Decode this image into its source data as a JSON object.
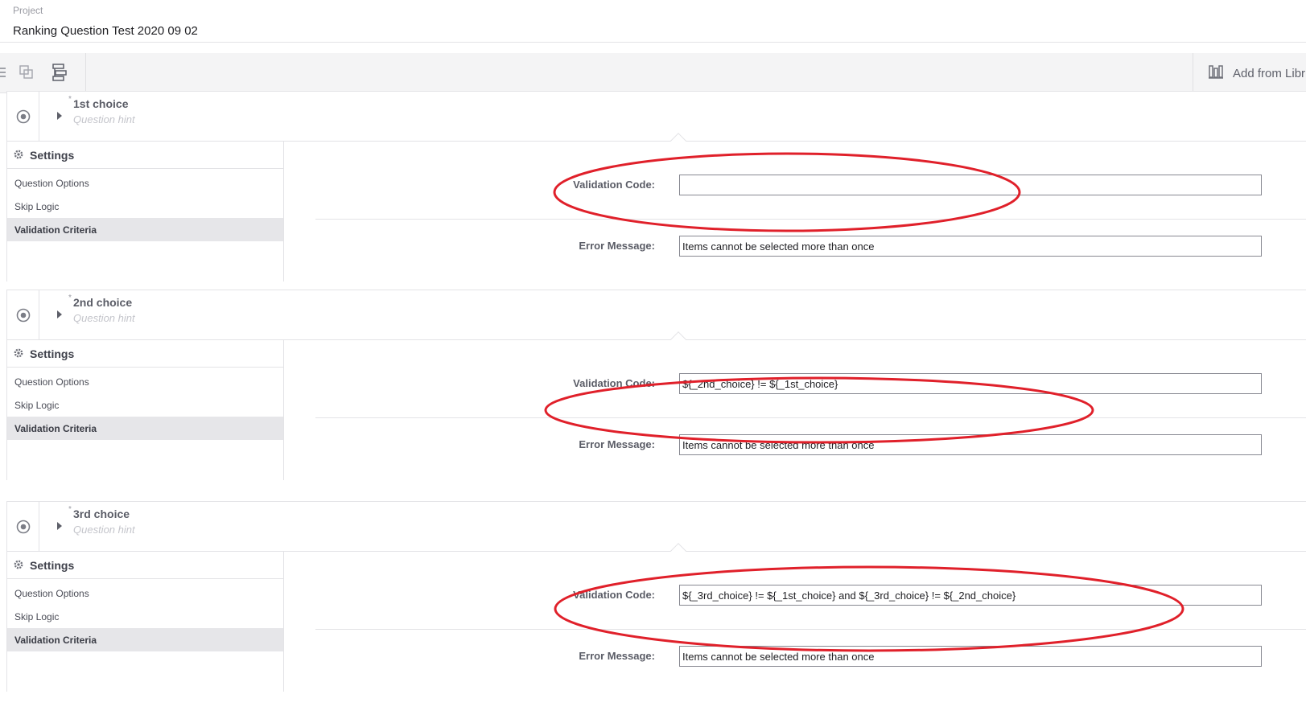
{
  "header": {
    "project_label": "Project",
    "project_title": "Ranking Question Test 2020 09 02"
  },
  "toolbar": {
    "add_from_library": "Add from Libr"
  },
  "questions": [
    {
      "required_mark": "*",
      "label": "1st choice",
      "hint": "Question hint",
      "settings_title": "Settings",
      "menu": [
        "Question Options",
        "Skip Logic",
        "Validation Criteria"
      ],
      "validation_code_label": "Validation Code:",
      "validation_code": "",
      "error_message_label": "Error Message:",
      "error_message": "Items cannot be selected more than once"
    },
    {
      "required_mark": "*",
      "label": "2nd choice",
      "hint": "Question hint",
      "settings_title": "Settings",
      "menu": [
        "Question Options",
        "Skip Logic",
        "Validation Criteria"
      ],
      "validation_code_label": "Validation Code:",
      "validation_code": "${_2nd_choice} != ${_1st_choice}",
      "error_message_label": "Error Message:",
      "error_message": "Items cannot be selected more than once"
    },
    {
      "required_mark": "*",
      "label": "3rd choice",
      "hint": "Question hint",
      "settings_title": "Settings",
      "menu": [
        "Question Options",
        "Skip Logic",
        "Validation Criteria"
      ],
      "validation_code_label": "Validation Code:",
      "validation_code": "${_3rd_choice} != ${_1st_choice} and ${_3rd_choice} != ${_2nd_choice}",
      "error_message_label": "Error Message:",
      "error_message": "Items cannot be selected more than once"
    }
  ],
  "colors": {
    "annotation": "#e0202a",
    "active_menu_bg": "#e6e6e9"
  },
  "icons": [
    "list-icon",
    "copy-icon",
    "hierarchy-icon",
    "library-icon",
    "radio-target-icon",
    "expand-caret-icon",
    "gear-icon"
  ]
}
